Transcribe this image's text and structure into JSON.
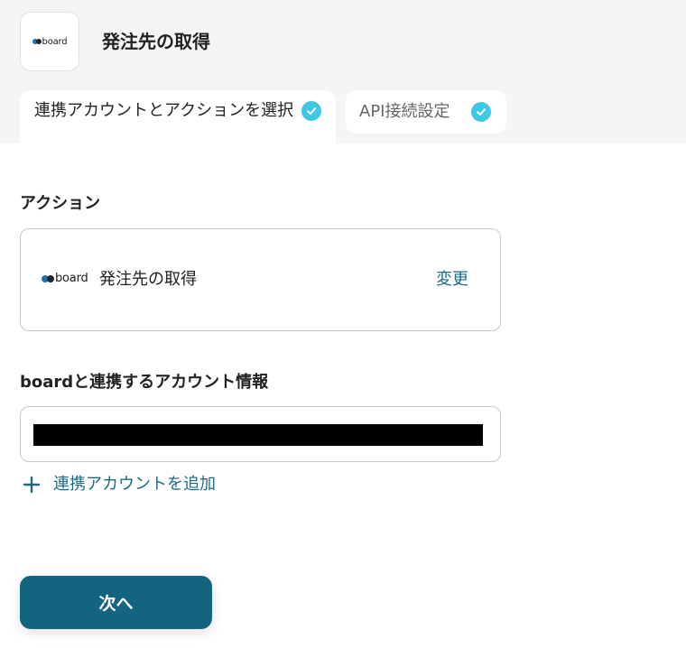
{
  "header": {
    "title": "発注先の取得",
    "logo_text": "board"
  },
  "tabs": [
    {
      "label": "連携アカウントとアクションを選択",
      "state": "active",
      "completed": true
    },
    {
      "label": "API接続設定",
      "state": "inactive",
      "completed": true
    }
  ],
  "action_section": {
    "label": "アクション",
    "card": {
      "logo_text": "board",
      "action_name": "発注先の取得",
      "change_label": "変更"
    }
  },
  "account_section": {
    "label": "boardと連携するアカウント情報",
    "add_account_label": "連携アカウントを追加"
  },
  "footer": {
    "next_label": "次へ"
  },
  "colors": {
    "accent": "#13657f",
    "link": "#1c6b88",
    "check": "#3ec8e4"
  },
  "icons": {
    "tab_check": "check-circle-icon",
    "add": "plus-icon"
  }
}
